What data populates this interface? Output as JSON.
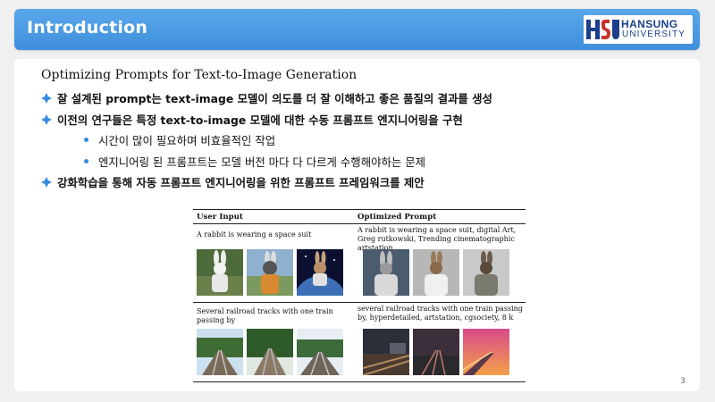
{
  "header": {
    "title": "Introduction",
    "logo_name": "HANSUNG",
    "logo_sub": "UNIVERSITY"
  },
  "colors": {
    "header_blue": "#4a9be4",
    "bullet_blue": "#3a8ae0",
    "logo_blue": "#1b3f8b"
  },
  "content": {
    "subtitle": "Optimizing Prompts for Text-to-Image Generation",
    "bullets": [
      {
        "level": 1,
        "icon": "diamond-bullet-icon",
        "text": "잘 설계된 prompt는 text-image 모델이 의도를 더 잘 이해하고 좋은 품질의 결과를 생성"
      },
      {
        "level": 1,
        "icon": "diamond-bullet-icon",
        "text": "이전의 연구들은 특정 text-to-image 모델에 대한 수동 프롬프트 엔지니어링을 구현"
      },
      {
        "level": 2,
        "icon": "dot-bullet-icon",
        "text": "시간이 많이 필요하며 비효율적인 작업"
      },
      {
        "level": 2,
        "icon": "dot-bullet-icon",
        "text": "엔지니어링 된 프롬프트는 모델 버전 마다 다 다르게 수행해야하는 문제"
      },
      {
        "level": 1,
        "icon": "diamond-bullet-icon",
        "text": "강화학습을 통해 자동 프롬프트 엔지니어링을 위한 프롬프트 프레임워크를 제안"
      }
    ]
  },
  "figure": {
    "col_user": "User Input",
    "col_opt": "Optimized Prompt",
    "rows": [
      {
        "user": "A rabbit is wearing a space suit",
        "opt": "A rabbit is wearing a space suit, digital Art, Greg rutkowski, Trending cinematographic artstation"
      },
      {
        "user": "Several railroad tracks with one train passing by",
        "opt": "several railroad tracks with one train passing by, hyperdetailed, artstation, cgsociety, 8 k"
      }
    ]
  },
  "page_number": "3"
}
